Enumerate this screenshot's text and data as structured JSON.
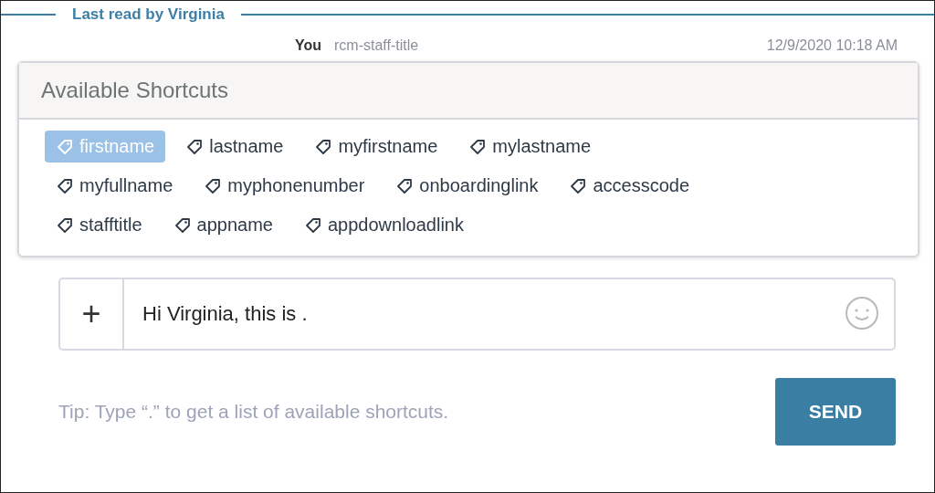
{
  "read_marker": "Last read by Virginia",
  "message_header": {
    "sender": "You",
    "role": "rcm-staff-title",
    "time": "12/9/2020 10:18 AM"
  },
  "shortcuts": {
    "title": "Available Shortcuts",
    "items": [
      {
        "label": "firstname",
        "selected": true
      },
      {
        "label": "lastname",
        "selected": false
      },
      {
        "label": "myfirstname",
        "selected": false
      },
      {
        "label": "mylastname",
        "selected": false
      },
      {
        "label": "myfullname",
        "selected": false
      },
      {
        "label": "myphonenumber",
        "selected": false
      },
      {
        "label": "onboardinglink",
        "selected": false
      },
      {
        "label": "accesscode",
        "selected": false
      },
      {
        "label": "stafftitle",
        "selected": false
      },
      {
        "label": "appname",
        "selected": false
      },
      {
        "label": "appdownloadlink",
        "selected": false
      }
    ]
  },
  "composer": {
    "add_symbol": "+",
    "value": "Hi Virginia, this is ."
  },
  "tip": "Tip: Type “.” to get a list of available shortcuts.",
  "send_button": "SEND"
}
